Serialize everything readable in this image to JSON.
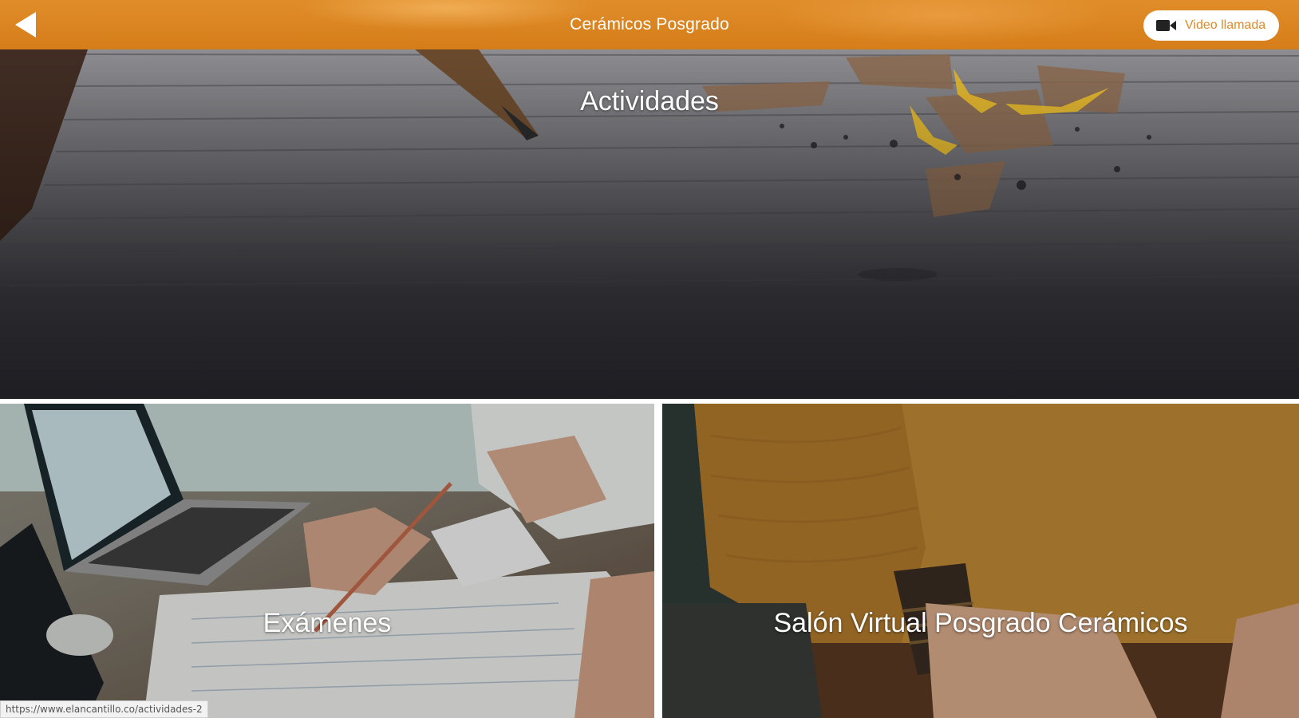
{
  "header": {
    "title": "Cerámicos Posgrado",
    "back_icon": "back-arrow-icon",
    "video_call": {
      "label": "Video llamada",
      "icon": "video-camera-icon"
    },
    "accent_color": "#e08a27"
  },
  "sections": {
    "activities": {
      "label": "Actividades"
    },
    "exams": {
      "label": "Exámenes"
    },
    "virtual_room": {
      "label": "Salón Virtual Posgrado Cerámicos"
    }
  },
  "status_bar": {
    "url": "https://www.elancantillo.co/actividades-2"
  }
}
